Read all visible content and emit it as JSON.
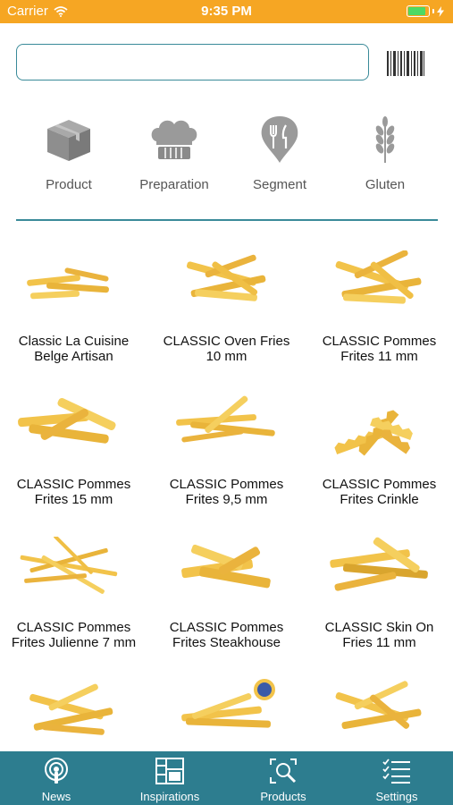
{
  "status_bar": {
    "carrier": "Carrier",
    "time": "9:35 PM",
    "battery_level": 1.0
  },
  "search": {
    "value": "",
    "placeholder": ""
  },
  "filters": [
    {
      "label": "Product",
      "icon": "box-icon"
    },
    {
      "label": "Preparation",
      "icon": "chef-hat-icon"
    },
    {
      "label": "Segment",
      "icon": "fork-knife-pin-icon"
    },
    {
      "label": "Gluten",
      "icon": "wheat-icon"
    }
  ],
  "products": [
    {
      "name": "Classic La Cuisine Belge Artisan"
    },
    {
      "name": "CLASSIC Oven Fries 10 mm"
    },
    {
      "name": "CLASSIC Pommes Frites 11 mm"
    },
    {
      "name": "CLASSIC Pommes Frites 15 mm"
    },
    {
      "name": "CLASSIC Pommes Frites 9,5 mm"
    },
    {
      "name": "CLASSIC Pommes Frites Crinkle"
    },
    {
      "name": "CLASSIC Pommes Frites Julienne 7 mm"
    },
    {
      "name": "CLASSIC Pommes Frites Steakhouse"
    },
    {
      "name": "CLASSIC Skin On Fries 11 mm"
    },
    {
      "name": ""
    },
    {
      "name": ""
    },
    {
      "name": ""
    }
  ],
  "tabs": [
    {
      "label": "News",
      "icon": "podcast-icon"
    },
    {
      "label": "Inspirations",
      "icon": "inspiration-board-icon"
    },
    {
      "label": "Products",
      "icon": "product-search-icon"
    },
    {
      "label": "Settings",
      "icon": "checklist-icon"
    }
  ],
  "colors": {
    "status_bar": "#f6a623",
    "accent": "#2d7d8f",
    "icon_gray": "#9a9a9a",
    "fries": "#f2c34a"
  }
}
